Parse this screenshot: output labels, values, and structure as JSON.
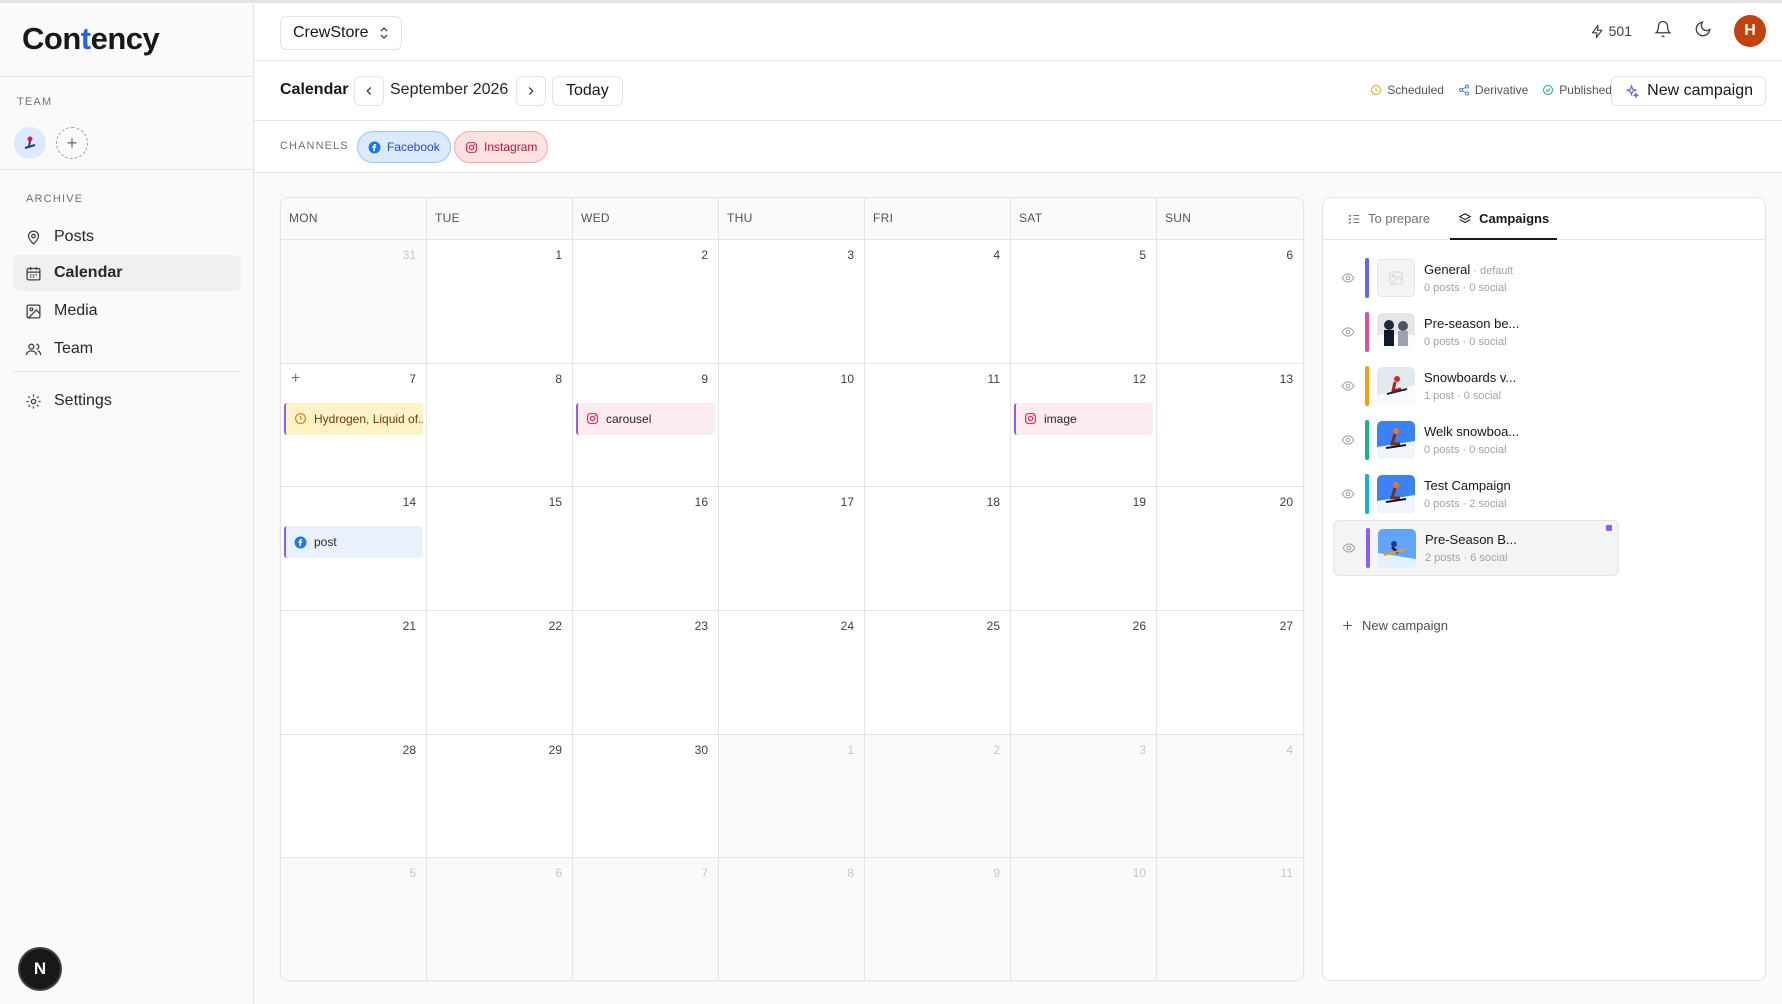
{
  "app": {
    "logo_pre": "Con",
    "logo_accent": "t",
    "logo_post": "ency"
  },
  "sidebar": {
    "team_label": "TEAM",
    "archive_label": "ARCHIVE",
    "items": [
      {
        "label": "Posts",
        "icon": "pin-icon"
      },
      {
        "label": "Calendar",
        "icon": "calendar-icon",
        "active": true
      },
      {
        "label": "Media",
        "icon": "image-icon"
      },
      {
        "label": "Team",
        "icon": "users-icon"
      }
    ],
    "settings_label": "Settings",
    "badge_letter": "N"
  },
  "header": {
    "store": "CrewStore",
    "credits": "501",
    "avatar_letter": "H",
    "avatar_color": "#c2410c"
  },
  "toolbar": {
    "title": "Calendar",
    "month": "September 2026",
    "today": "Today",
    "legend": {
      "scheduled": "Scheduled",
      "derivative": "Derivative",
      "published": "Published"
    },
    "new_campaign": "New campaign"
  },
  "channels": {
    "label": "CHANNELS",
    "facebook": "Facebook",
    "instagram": "Instagram"
  },
  "calendar": {
    "weekdays": [
      "MON",
      "TUE",
      "WED",
      "THU",
      "FRI",
      "SAT",
      "SUN"
    ],
    "days": [
      {
        "n": "31",
        "out": true
      },
      {
        "n": "1"
      },
      {
        "n": "2"
      },
      {
        "n": "3"
      },
      {
        "n": "4"
      },
      {
        "n": "5"
      },
      {
        "n": "6"
      },
      {
        "n": "7",
        "add": true,
        "event": {
          "type": "draft",
          "label": "Hydrogen, Liquid of..."
        }
      },
      {
        "n": "8"
      },
      {
        "n": "9",
        "event": {
          "type": "ig",
          "label": "carousel"
        }
      },
      {
        "n": "10"
      },
      {
        "n": "11"
      },
      {
        "n": "12",
        "event": {
          "type": "ig",
          "label": "image"
        }
      },
      {
        "n": "13"
      },
      {
        "n": "14",
        "event": {
          "type": "fb",
          "label": "post"
        }
      },
      {
        "n": "15"
      },
      {
        "n": "16"
      },
      {
        "n": "17"
      },
      {
        "n": "18"
      },
      {
        "n": "19"
      },
      {
        "n": "20"
      },
      {
        "n": "21"
      },
      {
        "n": "22"
      },
      {
        "n": "23"
      },
      {
        "n": "24"
      },
      {
        "n": "25"
      },
      {
        "n": "26"
      },
      {
        "n": "27"
      },
      {
        "n": "28"
      },
      {
        "n": "29"
      },
      {
        "n": "30"
      },
      {
        "n": "1",
        "out": true
      },
      {
        "n": "2",
        "out": true
      },
      {
        "n": "3",
        "out": true
      },
      {
        "n": "4",
        "out": true
      },
      {
        "n": "5",
        "out": true
      },
      {
        "n": "6",
        "out": true
      },
      {
        "n": "7",
        "out": true
      },
      {
        "n": "8",
        "out": true
      },
      {
        "n": "9",
        "out": true
      },
      {
        "n": "10",
        "out": true
      },
      {
        "n": "11",
        "out": true
      }
    ]
  },
  "panel": {
    "tabs": [
      {
        "label": "To prepare"
      },
      {
        "label": "Campaigns",
        "active": true
      }
    ],
    "campaigns": [
      {
        "name": "General",
        "tag": " · default",
        "meta": "0 posts · 0 social",
        "color": "#6366f1",
        "thumb": "placeholder"
      },
      {
        "name": "Pre-season be...",
        "tag": "",
        "meta": "0 posts · 0 social",
        "color": "#ec4899",
        "thumb": "people"
      },
      {
        "name": "Snowboards v...",
        "tag": "",
        "meta": "1 post · 0 social",
        "color": "#f59e0b",
        "thumb": "snow-light"
      },
      {
        "name": "Welk snowboa...",
        "tag": "",
        "meta": "0 posts · 0 social",
        "color": "#10b981",
        "thumb": "snow-blue"
      },
      {
        "name": "Test Campaign",
        "tag": "",
        "meta": "0 posts · 2 social",
        "color": "#06b6d4",
        "thumb": "snow-blue"
      },
      {
        "name": "Pre-Season B...",
        "tag": "",
        "meta": "2 posts · 6 social",
        "color": "#8b5cf6",
        "thumb": "snow-sky",
        "selected": true
      }
    ],
    "new_campaign": "New campaign"
  }
}
